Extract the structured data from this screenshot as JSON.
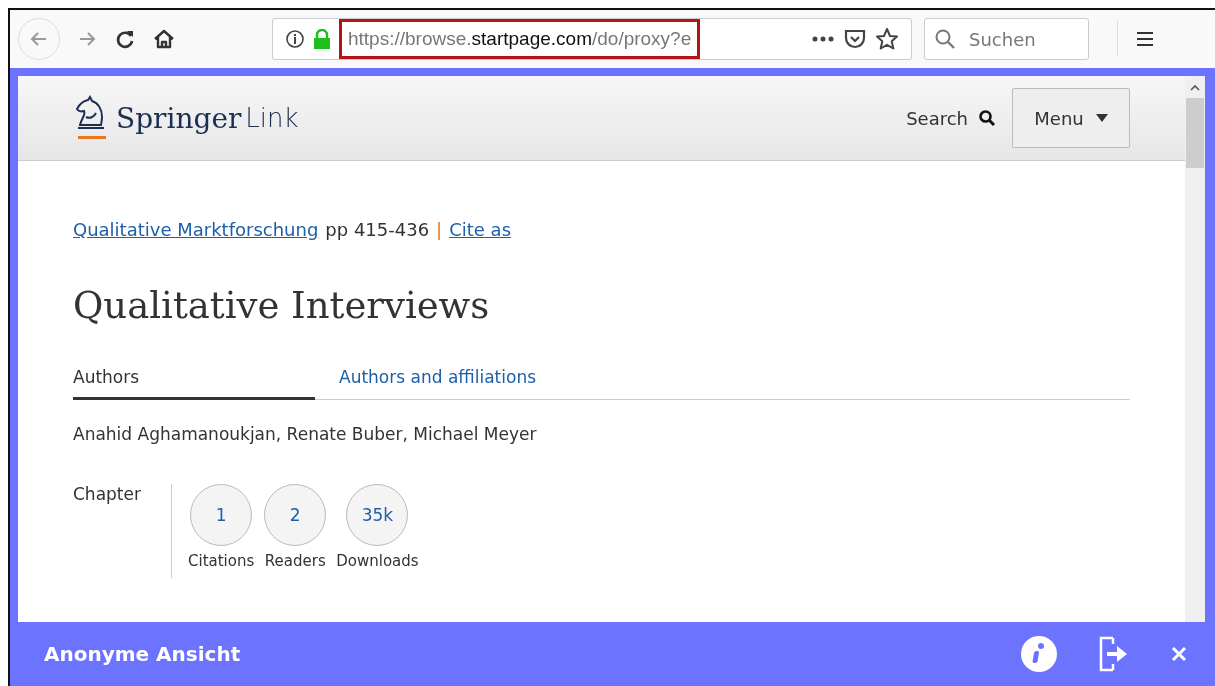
{
  "browser": {
    "url_parts": [
      {
        "kind": "muted",
        "text": "https://browse."
      },
      {
        "kind": "domain",
        "text": "startpage.com"
      },
      {
        "kind": "muted",
        "text": "/do/proxy?e"
      }
    ],
    "url_highlighted": true,
    "search": {
      "placeholder": "Suchen"
    }
  },
  "site": {
    "logo": {
      "name": "Springer",
      "suffix": "Link"
    },
    "search_label": "Search",
    "menu_label": "Menu"
  },
  "breadcrumb": {
    "book": "Qualitative Marktforschung",
    "pages": "pp 415-436",
    "separator": "|",
    "cite": "Cite as"
  },
  "title": "Qualitative Interviews",
  "tabs": [
    {
      "label": "Authors",
      "selected": true
    },
    {
      "label": "Authors and affiliations",
      "selected": false
    }
  ],
  "authors": "Anahid Aghamanoukjan, Renate Buber, Michael Meyer",
  "metrics": {
    "label": "Chapter",
    "items": [
      {
        "value": "1",
        "label": "Citations"
      },
      {
        "value": "2",
        "label": "Readers"
      },
      {
        "value": "35k",
        "label": "Downloads"
      }
    ]
  },
  "proxy_bar": {
    "title": "Anonyme Ansicht"
  }
}
